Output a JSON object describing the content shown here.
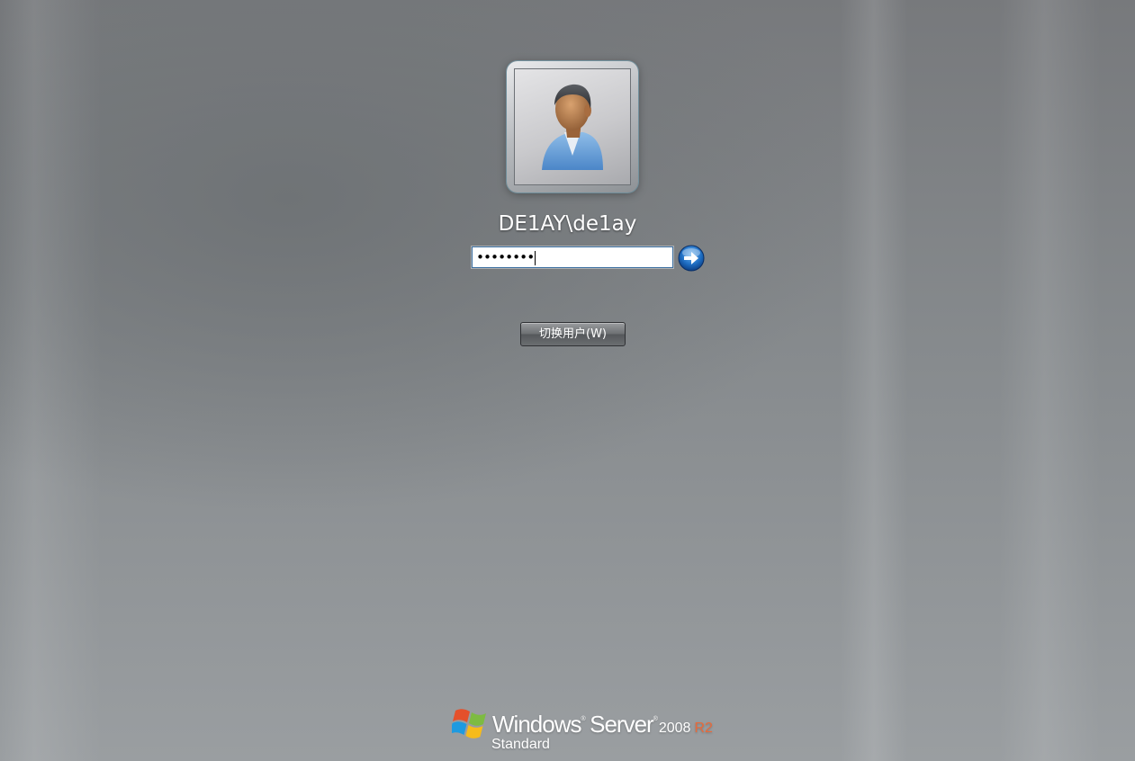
{
  "user": {
    "name": "DE1AY\\de1ay",
    "avatar_icon": "user-avatar-icon"
  },
  "password": {
    "masked_value": "••••••••",
    "submit_icon": "arrow-right-icon"
  },
  "switch_user": {
    "label": "切换用户(W)"
  },
  "brand": {
    "logo_icon": "windows-flag-icon",
    "windows": "Windows",
    "server": "Server",
    "trademark": "®",
    "year": "2008",
    "release": "R2",
    "edition": "Standard"
  },
  "colors": {
    "accent_blue": "#1f6fc4",
    "release_orange": "#e86a3a"
  }
}
